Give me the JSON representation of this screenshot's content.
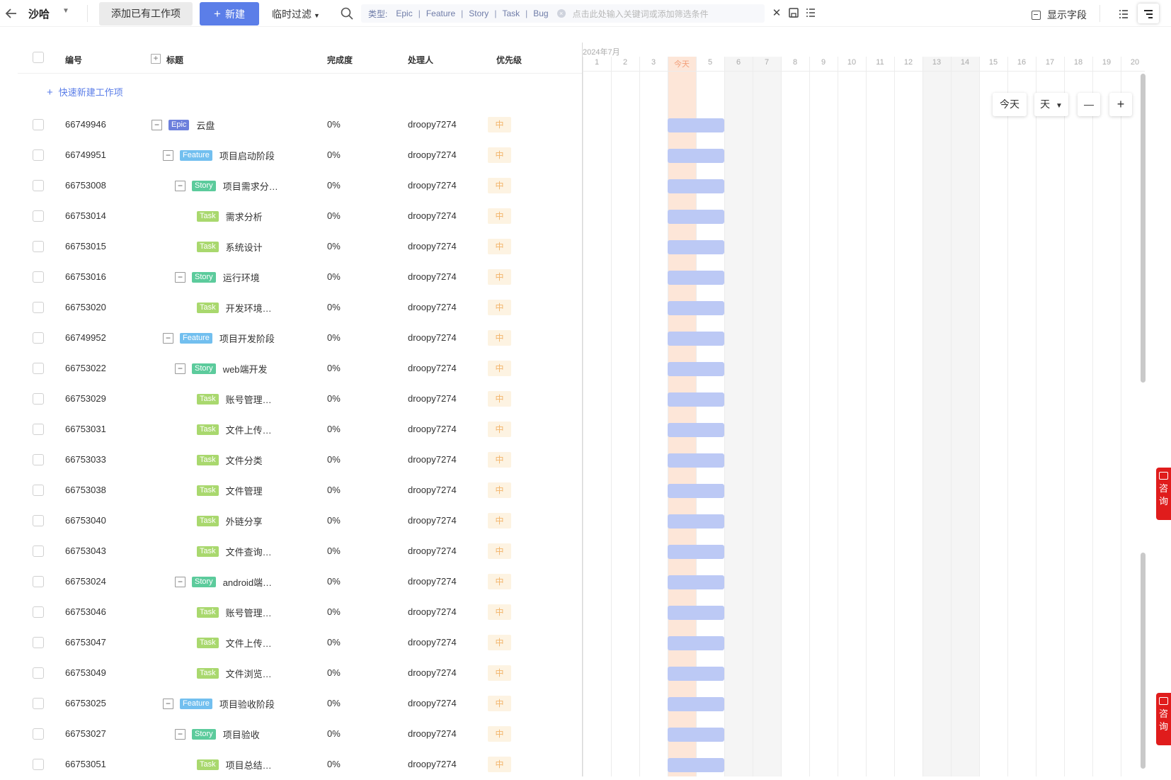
{
  "toolbar": {
    "project_name": "沙哈",
    "add_existing_label": "添加已有工作项",
    "new_label": "新建",
    "filter_label": "临时过滤",
    "filter": {
      "type_label": "类型:",
      "types": [
        "Epic",
        "Feature",
        "Story",
        "Task",
        "Bug"
      ],
      "placeholder": "点击此处输入关键词或添加筛选条件"
    },
    "fields_label": "显示字段",
    "view_toggle_active": "gantt"
  },
  "table": {
    "headers": {
      "id": "编号",
      "title": "标题",
      "progress": "完成度",
      "assignee": "处理人",
      "priority": "优先级"
    },
    "quick_create_label": "快速新建工作项",
    "rows": [
      {
        "id": "66749946",
        "type": "Epic",
        "title": "云盘",
        "level": 0,
        "collapsible": true,
        "progress": "0%",
        "assignee": "droopy7274",
        "priority": "中"
      },
      {
        "id": "66749951",
        "type": "Feature",
        "title": "项目启动阶段",
        "level": 1,
        "collapsible": true,
        "progress": "0%",
        "assignee": "droopy7274",
        "priority": "中"
      },
      {
        "id": "66753008",
        "type": "Story",
        "title": "项目需求分…",
        "level": 2,
        "collapsible": true,
        "progress": "0%",
        "assignee": "droopy7274",
        "priority": "中"
      },
      {
        "id": "66753014",
        "type": "Task",
        "title": "需求分析",
        "level": 3,
        "collapsible": false,
        "progress": "0%",
        "assignee": "droopy7274",
        "priority": "中"
      },
      {
        "id": "66753015",
        "type": "Task",
        "title": "系统设计",
        "level": 3,
        "collapsible": false,
        "progress": "0%",
        "assignee": "droopy7274",
        "priority": "中"
      },
      {
        "id": "66753016",
        "type": "Story",
        "title": "运行环境",
        "level": 2,
        "collapsible": true,
        "progress": "0%",
        "assignee": "droopy7274",
        "priority": "中"
      },
      {
        "id": "66753020",
        "type": "Task",
        "title": "开发环境…",
        "level": 3,
        "collapsible": false,
        "progress": "0%",
        "assignee": "droopy7274",
        "priority": "中"
      },
      {
        "id": "66749952",
        "type": "Feature",
        "title": "项目开发阶段",
        "level": 1,
        "collapsible": true,
        "progress": "0%",
        "assignee": "droopy7274",
        "priority": "中"
      },
      {
        "id": "66753022",
        "type": "Story",
        "title": "web端开发",
        "level": 2,
        "collapsible": true,
        "progress": "0%",
        "assignee": "droopy7274",
        "priority": "中"
      },
      {
        "id": "66753029",
        "type": "Task",
        "title": "账号管理…",
        "level": 3,
        "collapsible": false,
        "progress": "0%",
        "assignee": "droopy7274",
        "priority": "中"
      },
      {
        "id": "66753031",
        "type": "Task",
        "title": "文件上传…",
        "level": 3,
        "collapsible": false,
        "progress": "0%",
        "assignee": "droopy7274",
        "priority": "中"
      },
      {
        "id": "66753033",
        "type": "Task",
        "title": "文件分类",
        "level": 3,
        "collapsible": false,
        "progress": "0%",
        "assignee": "droopy7274",
        "priority": "中"
      },
      {
        "id": "66753038",
        "type": "Task",
        "title": "文件管理",
        "level": 3,
        "collapsible": false,
        "progress": "0%",
        "assignee": "droopy7274",
        "priority": "中"
      },
      {
        "id": "66753040",
        "type": "Task",
        "title": "外链分享",
        "level": 3,
        "collapsible": false,
        "progress": "0%",
        "assignee": "droopy7274",
        "priority": "中"
      },
      {
        "id": "66753043",
        "type": "Task",
        "title": "文件查询…",
        "level": 3,
        "collapsible": false,
        "progress": "0%",
        "assignee": "droopy7274",
        "priority": "中"
      },
      {
        "id": "66753024",
        "type": "Story",
        "title": "android端…",
        "level": 2,
        "collapsible": true,
        "progress": "0%",
        "assignee": "droopy7274",
        "priority": "中"
      },
      {
        "id": "66753046",
        "type": "Task",
        "title": "账号管理…",
        "level": 3,
        "collapsible": false,
        "progress": "0%",
        "assignee": "droopy7274",
        "priority": "中"
      },
      {
        "id": "66753047",
        "type": "Task",
        "title": "文件上传…",
        "level": 3,
        "collapsible": false,
        "progress": "0%",
        "assignee": "droopy7274",
        "priority": "中"
      },
      {
        "id": "66753049",
        "type": "Task",
        "title": "文件浏览…",
        "level": 3,
        "collapsible": false,
        "progress": "0%",
        "assignee": "droopy7274",
        "priority": "中"
      },
      {
        "id": "66753025",
        "type": "Feature",
        "title": "项目验收阶段",
        "level": 1,
        "collapsible": true,
        "progress": "0%",
        "assignee": "droopy7274",
        "priority": "中"
      },
      {
        "id": "66753027",
        "type": "Story",
        "title": "项目验收",
        "level": 2,
        "collapsible": true,
        "progress": "0%",
        "assignee": "droopy7274",
        "priority": "中"
      },
      {
        "id": "66753051",
        "type": "Task",
        "title": "项目总结…",
        "level": 3,
        "collapsible": false,
        "progress": "0%",
        "assignee": "droopy7274",
        "priority": "中"
      }
    ]
  },
  "gantt": {
    "month_label": "2024年7月",
    "days": [
      "1",
      "2",
      "3",
      "今天",
      "5",
      "6",
      "7",
      "8",
      "9",
      "10",
      "11",
      "12",
      "13",
      "14",
      "15",
      "16",
      "17",
      "18",
      "19",
      "20"
    ],
    "today_index": 3,
    "weekend_indices": [
      5,
      6,
      12,
      13
    ],
    "bar_start_index": 3,
    "bar_span_days": 2,
    "today_button": "今天",
    "scale_button": "天",
    "zoom_out": "—",
    "zoom_in": "+"
  },
  "consult_label": [
    "咨",
    "询"
  ],
  "colors": {
    "primary": "#5b7ee8",
    "epic": "#6c7fdc",
    "feature": "#72bfef",
    "story": "#5ccb9c",
    "task": "#a9d86e",
    "bar": "#bcc9f5",
    "today": "#fde6d8",
    "priority_bg": "#fdf3e2",
    "priority_text": "#f2b46a",
    "consult": "#e01c1c"
  }
}
